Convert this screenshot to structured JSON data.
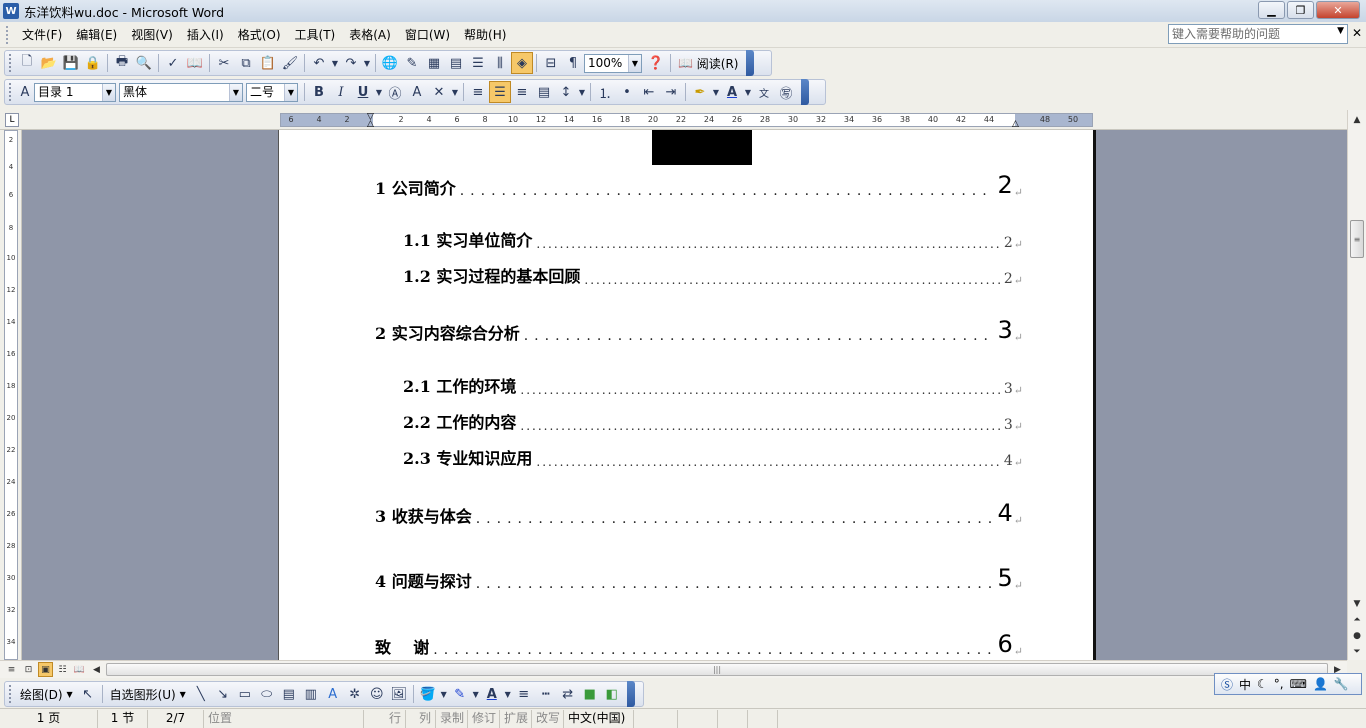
{
  "window": {
    "title": "东洋饮料wu.doc - Microsoft Word",
    "app_icon": "W",
    "buttons": [
      "minimize",
      "restore",
      "close"
    ]
  },
  "menubar": {
    "items": [
      "文件(F)",
      "编辑(E)",
      "视图(V)",
      "插入(I)",
      "格式(O)",
      "工具(T)",
      "表格(A)",
      "窗口(W)",
      "帮助(H)"
    ],
    "help_placeholder": "键入需要帮助的问题"
  },
  "standard_toolbar": {
    "zoom": "100%",
    "read_label": "阅读(R)"
  },
  "format_toolbar": {
    "style": "目录 1",
    "font": "黑体",
    "size": "二号"
  },
  "ruler": {
    "ticks": [
      "6",
      "4",
      "2",
      "2",
      "4",
      "6",
      "8",
      "10",
      "12",
      "14",
      "16",
      "18",
      "20",
      "22",
      "24",
      "26",
      "28",
      "30",
      "32",
      "34",
      "36",
      "38",
      "40",
      "42",
      "44",
      "48",
      "50"
    ],
    "vticks": [
      "2",
      "4",
      "6",
      "8",
      "10",
      "12",
      "14",
      "16",
      "18",
      "20",
      "22",
      "24",
      "26",
      "28",
      "30",
      "32",
      "34"
    ]
  },
  "toc": {
    "entries": [
      {
        "level": 1,
        "label": "1  公司简介",
        "page": "2"
      },
      {
        "level": 2,
        "label": "1.1  实习单位简介",
        "page": "2"
      },
      {
        "level": 2,
        "label": "1.2  实习过程的基本回顾",
        "page": "2"
      },
      {
        "level": 1,
        "label": "2  实习内容综合分析",
        "page": "3"
      },
      {
        "level": 2,
        "label": "2.1  工作的环境",
        "page": "3"
      },
      {
        "level": 2,
        "label": "2.2  工作的内容",
        "page": "3"
      },
      {
        "level": 2,
        "label": "2.3  专业知识应用",
        "page": "4"
      },
      {
        "level": 1,
        "label": "3  收获与体会",
        "page": "4"
      },
      {
        "level": 1,
        "label": "4  问题与探讨",
        "page": "5"
      },
      {
        "level": 1,
        "label": "致    谢",
        "page": "6"
      }
    ],
    "paragraph_mark": "↵"
  },
  "drawing_toolbar": {
    "draw_label": "绘图(D)",
    "autoshapes_label": "自选图形(U)"
  },
  "ime": {
    "lang": "中"
  },
  "statusbar": {
    "page": "1 页",
    "section": "1 节",
    "pages": "2/7",
    "position": "位置",
    "line": "行",
    "column": "列",
    "rec": "录制",
    "trk": "修订",
    "ext": "扩展",
    "ovr": "改写",
    "language": "中文(中国)"
  }
}
